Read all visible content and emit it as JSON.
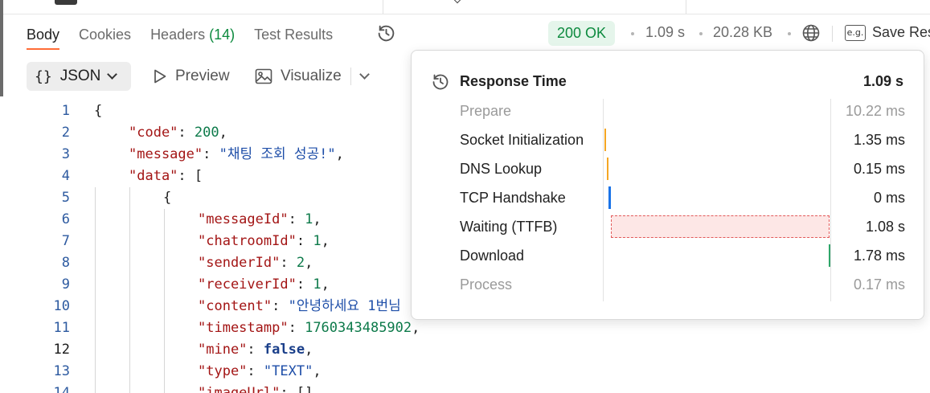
{
  "tabs": [
    {
      "label": "Body",
      "active": true
    },
    {
      "label": "Cookies",
      "active": false
    },
    {
      "label": "Headers ",
      "count": "(14)",
      "active": false
    },
    {
      "label": "Test Results",
      "active": false
    }
  ],
  "status": {
    "code_label": "200 OK",
    "time": "1.09 s",
    "size": "20.28 KB",
    "save_label": "Save Res",
    "save_icon_text": "e.g.",
    "ok_color": "#0c8a3e"
  },
  "toolbar": {
    "format_braces": "{}",
    "format_label": "JSON",
    "preview_label": "Preview",
    "visualize_label": "Visualize"
  },
  "code": {
    "current_line": 12,
    "lines": [
      {
        "n": "1",
        "parts": [
          {
            "t": "{",
            "c": "p"
          }
        ]
      },
      {
        "n": "2",
        "parts": [
          {
            "t": "\"code\"",
            "c": "k"
          },
          {
            "t": ": ",
            "c": "p"
          },
          {
            "t": "200",
            "c": "n"
          },
          {
            "t": ",",
            "c": "p"
          }
        ]
      },
      {
        "n": "3",
        "parts": [
          {
            "t": "\"message\"",
            "c": "k"
          },
          {
            "t": ": ",
            "c": "p"
          },
          {
            "t": "\"채팅 조회 성공!\"",
            "c": "s"
          },
          {
            "t": ",",
            "c": "p"
          }
        ]
      },
      {
        "n": "4",
        "parts": [
          {
            "t": "\"data\"",
            "c": "k"
          },
          {
            "t": ": [",
            "c": "p"
          }
        ]
      },
      {
        "n": "5",
        "parts": [
          {
            "t": "{",
            "c": "p"
          }
        ]
      },
      {
        "n": "6",
        "parts": [
          {
            "t": "\"messageId\"",
            "c": "k"
          },
          {
            "t": ": ",
            "c": "p"
          },
          {
            "t": "1",
            "c": "n"
          },
          {
            "t": ",",
            "c": "p"
          }
        ]
      },
      {
        "n": "7",
        "parts": [
          {
            "t": "\"chatroomId\"",
            "c": "k"
          },
          {
            "t": ": ",
            "c": "p"
          },
          {
            "t": "1",
            "c": "n"
          },
          {
            "t": ",",
            "c": "p"
          }
        ]
      },
      {
        "n": "8",
        "parts": [
          {
            "t": "\"senderId\"",
            "c": "k"
          },
          {
            "t": ": ",
            "c": "p"
          },
          {
            "t": "2",
            "c": "n"
          },
          {
            "t": ",",
            "c": "p"
          }
        ]
      },
      {
        "n": "9",
        "parts": [
          {
            "t": "\"receiverId\"",
            "c": "k"
          },
          {
            "t": ": ",
            "c": "p"
          },
          {
            "t": "1",
            "c": "n"
          },
          {
            "t": ",",
            "c": "p"
          }
        ]
      },
      {
        "n": "10",
        "parts": [
          {
            "t": "\"content\"",
            "c": "k"
          },
          {
            "t": ": ",
            "c": "p"
          },
          {
            "t": "\"안녕하세요 1번님",
            "c": "s"
          }
        ]
      },
      {
        "n": "11",
        "parts": [
          {
            "t": "\"timestamp\"",
            "c": "k"
          },
          {
            "t": ": ",
            "c": "p"
          },
          {
            "t": "1760343485902",
            "c": "n"
          },
          {
            "t": ",",
            "c": "p"
          }
        ]
      },
      {
        "n": "12",
        "parts": [
          {
            "t": "\"mine\"",
            "c": "k"
          },
          {
            "t": ": ",
            "c": "p"
          },
          {
            "t": "false",
            "c": "b"
          },
          {
            "t": ",",
            "c": "p"
          }
        ]
      },
      {
        "n": "13",
        "parts": [
          {
            "t": "\"type\"",
            "c": "k"
          },
          {
            "t": ": ",
            "c": "p"
          },
          {
            "t": "\"TEXT\"",
            "c": "s"
          },
          {
            "t": ",",
            "c": "p"
          }
        ]
      },
      {
        "n": "14",
        "parts": [
          {
            "t": "\"imageUrl\"",
            "c": "k"
          },
          {
            "t": ": []",
            "c": "p"
          }
        ]
      }
    ]
  },
  "response_time": {
    "title": "Response Time",
    "total": "1.09 s",
    "phases": [
      {
        "label": "Prepare",
        "value": "10.22 ms",
        "muted": true,
        "color": ""
      },
      {
        "label": "Socket Initialization",
        "value": "1.35 ms",
        "muted": false,
        "color": "#f5a623"
      },
      {
        "label": "DNS Lookup",
        "value": "0.15 ms",
        "muted": false,
        "color": "#f5a623"
      },
      {
        "label": "TCP Handshake",
        "value": "0 ms",
        "muted": false,
        "color": "#1a73e8"
      },
      {
        "label": "Waiting (TTFB)",
        "value": "1.08 s",
        "muted": false,
        "color": "#e25a5a"
      },
      {
        "label": "Download",
        "value": "1.78 ms",
        "muted": false,
        "color": "#2fa66a"
      },
      {
        "label": "Process",
        "value": "0.17 ms",
        "muted": true,
        "color": ""
      }
    ]
  }
}
